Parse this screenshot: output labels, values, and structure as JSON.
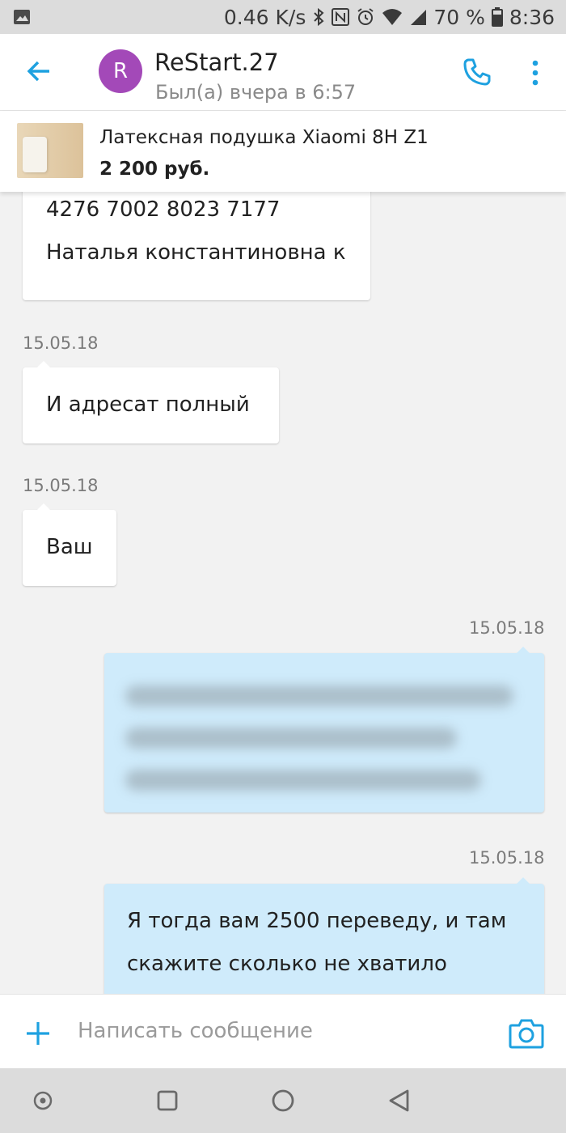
{
  "status_bar": {
    "speed": "0.46 K/s",
    "battery": "70 %",
    "time": "8:36"
  },
  "header": {
    "avatar_letter": "R",
    "title": "ReStart.27",
    "subtitle": "Был(а) вчера в 6:57"
  },
  "product": {
    "name": "Латексная подушка Xiaomi 8H Z1",
    "price": "2 200 руб."
  },
  "messages": [
    {
      "direction": "in",
      "lines": [
        "4276 7002 8023 7177",
        "Наталья константиновна к"
      ]
    },
    {
      "direction": "in",
      "date": "15.05.18",
      "lines": [
        "И адресат полный"
      ]
    },
    {
      "direction": "in",
      "date": "15.05.18",
      "lines": [
        "Ваш"
      ]
    },
    {
      "direction": "out",
      "date": "15.05.18",
      "blurred": true
    },
    {
      "direction": "out",
      "date": "15.05.18",
      "lines": [
        "Я тогда вам 2500 переведу, и там",
        "скажите сколько не хватило"
      ]
    }
  ],
  "input": {
    "placeholder": "Написать сообщение"
  },
  "colors": {
    "accent": "#1ea1e0",
    "avatar": "#a349b8",
    "outgoing_bubble": "#cfebfb",
    "incoming_bubble": "#ffffff"
  },
  "icons": [
    "image-icon",
    "bluetooth-icon",
    "nfc-icon",
    "alarm-icon",
    "wifi-icon",
    "signal-icon",
    "battery-icon",
    "back-arrow-icon",
    "phone-icon",
    "more-vert-icon",
    "plus-icon",
    "camera-icon",
    "nav-dot-icon",
    "nav-square-icon",
    "nav-circle-icon",
    "nav-back-triangle-icon"
  ]
}
